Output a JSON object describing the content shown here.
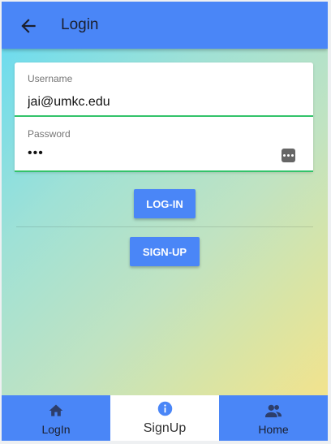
{
  "header": {
    "title": "Login",
    "back_icon": "arrow-back-icon"
  },
  "form": {
    "username": {
      "label": "Username",
      "value": "jai@umkc.edu"
    },
    "password": {
      "label": "Password",
      "value": "•••",
      "toggle_icon": "show-password-icon"
    }
  },
  "buttons": {
    "login": "LOG-IN",
    "signup": "SIGN-UP"
  },
  "tabs": [
    {
      "label": "LogIn",
      "icon": "home-icon",
      "active": false
    },
    {
      "label": "SignUp",
      "icon": "info-icon",
      "active": true
    },
    {
      "label": "Home",
      "icon": "people-icon",
      "active": false
    }
  ],
  "colors": {
    "primary": "#4a86f7",
    "field_underline": "#33c36a",
    "active_tab": "#ffffff"
  }
}
